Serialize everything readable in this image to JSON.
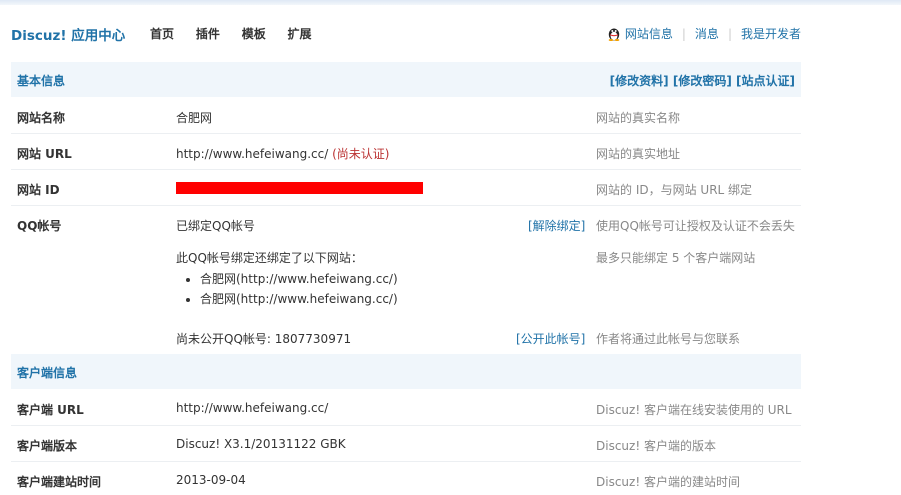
{
  "header": {
    "logo": "Discuz! 应用中心",
    "nav": [
      "首页",
      "插件",
      "模板",
      "扩展"
    ],
    "toplinks": [
      "网站信息",
      "消息",
      "我是开发者"
    ]
  },
  "basic": {
    "title": "基本信息",
    "actions": [
      "[修改资料]",
      "[修改密码]",
      "[站点认证]"
    ],
    "rows": [
      {
        "label": "网站名称",
        "value": "合肥网",
        "desc": "网站的真实名称"
      },
      {
        "label": "网站 URL",
        "value": "http://www.hefeiwang.cc/",
        "status": "(尚未认证)",
        "desc": "网站的真实地址"
      },
      {
        "label": "网站 ID",
        "value": "",
        "desc": "网站的 ID，与网站 URL 绑定"
      }
    ]
  },
  "qq": {
    "label": "QQ帐号",
    "bound_text": "已绑定QQ帐号",
    "unbind": "[解除绑定]",
    "desc1": "使用QQ帐号可让授权及认证不会丢失",
    "also_bound": "此QQ帐号绑定还绑定了以下网站：",
    "desc2": "最多只能绑定 5 个客户端网站",
    "sites": [
      "合肥网(http://www.hefeiwang.cc/)",
      "合肥网(http://www.hefeiwang.cc/)"
    ],
    "public_text": "尚未公开QQ帐号: 1807730971",
    "make_public": "[公开此帐号]",
    "desc3": "作者将通过此帐号与您联系"
  },
  "client": {
    "title": "客户端信息",
    "rows": [
      {
        "label": "客户端 URL",
        "value": "http://www.hefeiwang.cc/",
        "desc": "Discuz! 客户端在线安装使用的 URL"
      },
      {
        "label": "客户端版本",
        "value": "Discuz! X3.1/20131122 GBK",
        "desc": "Discuz! 客户端的版本"
      },
      {
        "label": "客户端建站时间",
        "value": "2013-09-04",
        "desc": "Discuz! 客户端的建站时间"
      }
    ]
  }
}
